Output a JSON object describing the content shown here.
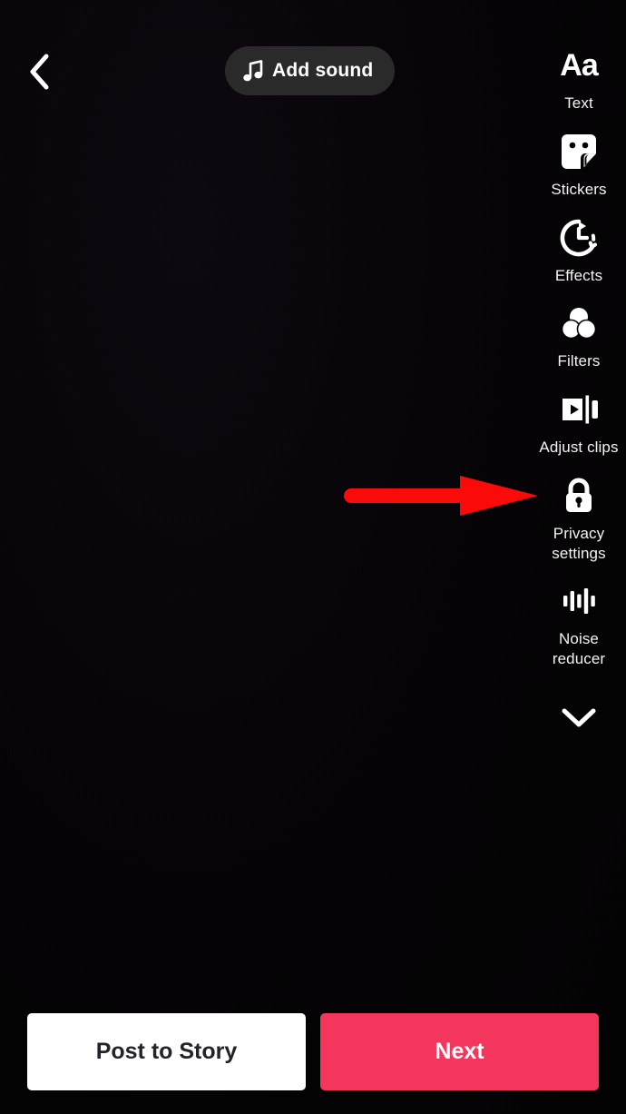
{
  "screen": {
    "name": "video-editor",
    "background_color": "#040304"
  },
  "top_bar": {
    "back_icon": "chevron-left-icon",
    "add_sound": {
      "label": "Add sound",
      "icon": "music-note-icon",
      "background_color": "#2b2a2b",
      "text_color": "#ffffff"
    }
  },
  "tool_rail": {
    "items": [
      {
        "id": "text",
        "label": "Text",
        "icon": "text-aa-icon"
      },
      {
        "id": "stickers",
        "label": "Stickers",
        "icon": "sticker-icon"
      },
      {
        "id": "effects",
        "label": "Effects",
        "icon": "effects-clock-icon"
      },
      {
        "id": "filters",
        "label": "Filters",
        "icon": "filters-circles-icon"
      },
      {
        "id": "adjust-clips",
        "label": "Adjust clips",
        "icon": "adjust-clips-icon"
      },
      {
        "id": "privacy-settings",
        "label": "Privacy\nsettings",
        "icon": "lock-icon"
      },
      {
        "id": "noise-reducer",
        "label": "Noise\nreducer",
        "icon": "waveform-icon"
      }
    ],
    "expand_more_icon": "chevron-down-icon",
    "label_color": "#f3f3f3"
  },
  "annotation": {
    "type": "arrow",
    "direction": "right",
    "color": "#fb0a0a",
    "points_at": "adjust-clips"
  },
  "bottom_bar": {
    "post_to_story": {
      "label": "Post to Story",
      "background_color": "#ffffff",
      "text_color": "#25222a"
    },
    "next": {
      "label": "Next",
      "background_color": "#f5365c",
      "text_color": "#ffffff"
    }
  }
}
